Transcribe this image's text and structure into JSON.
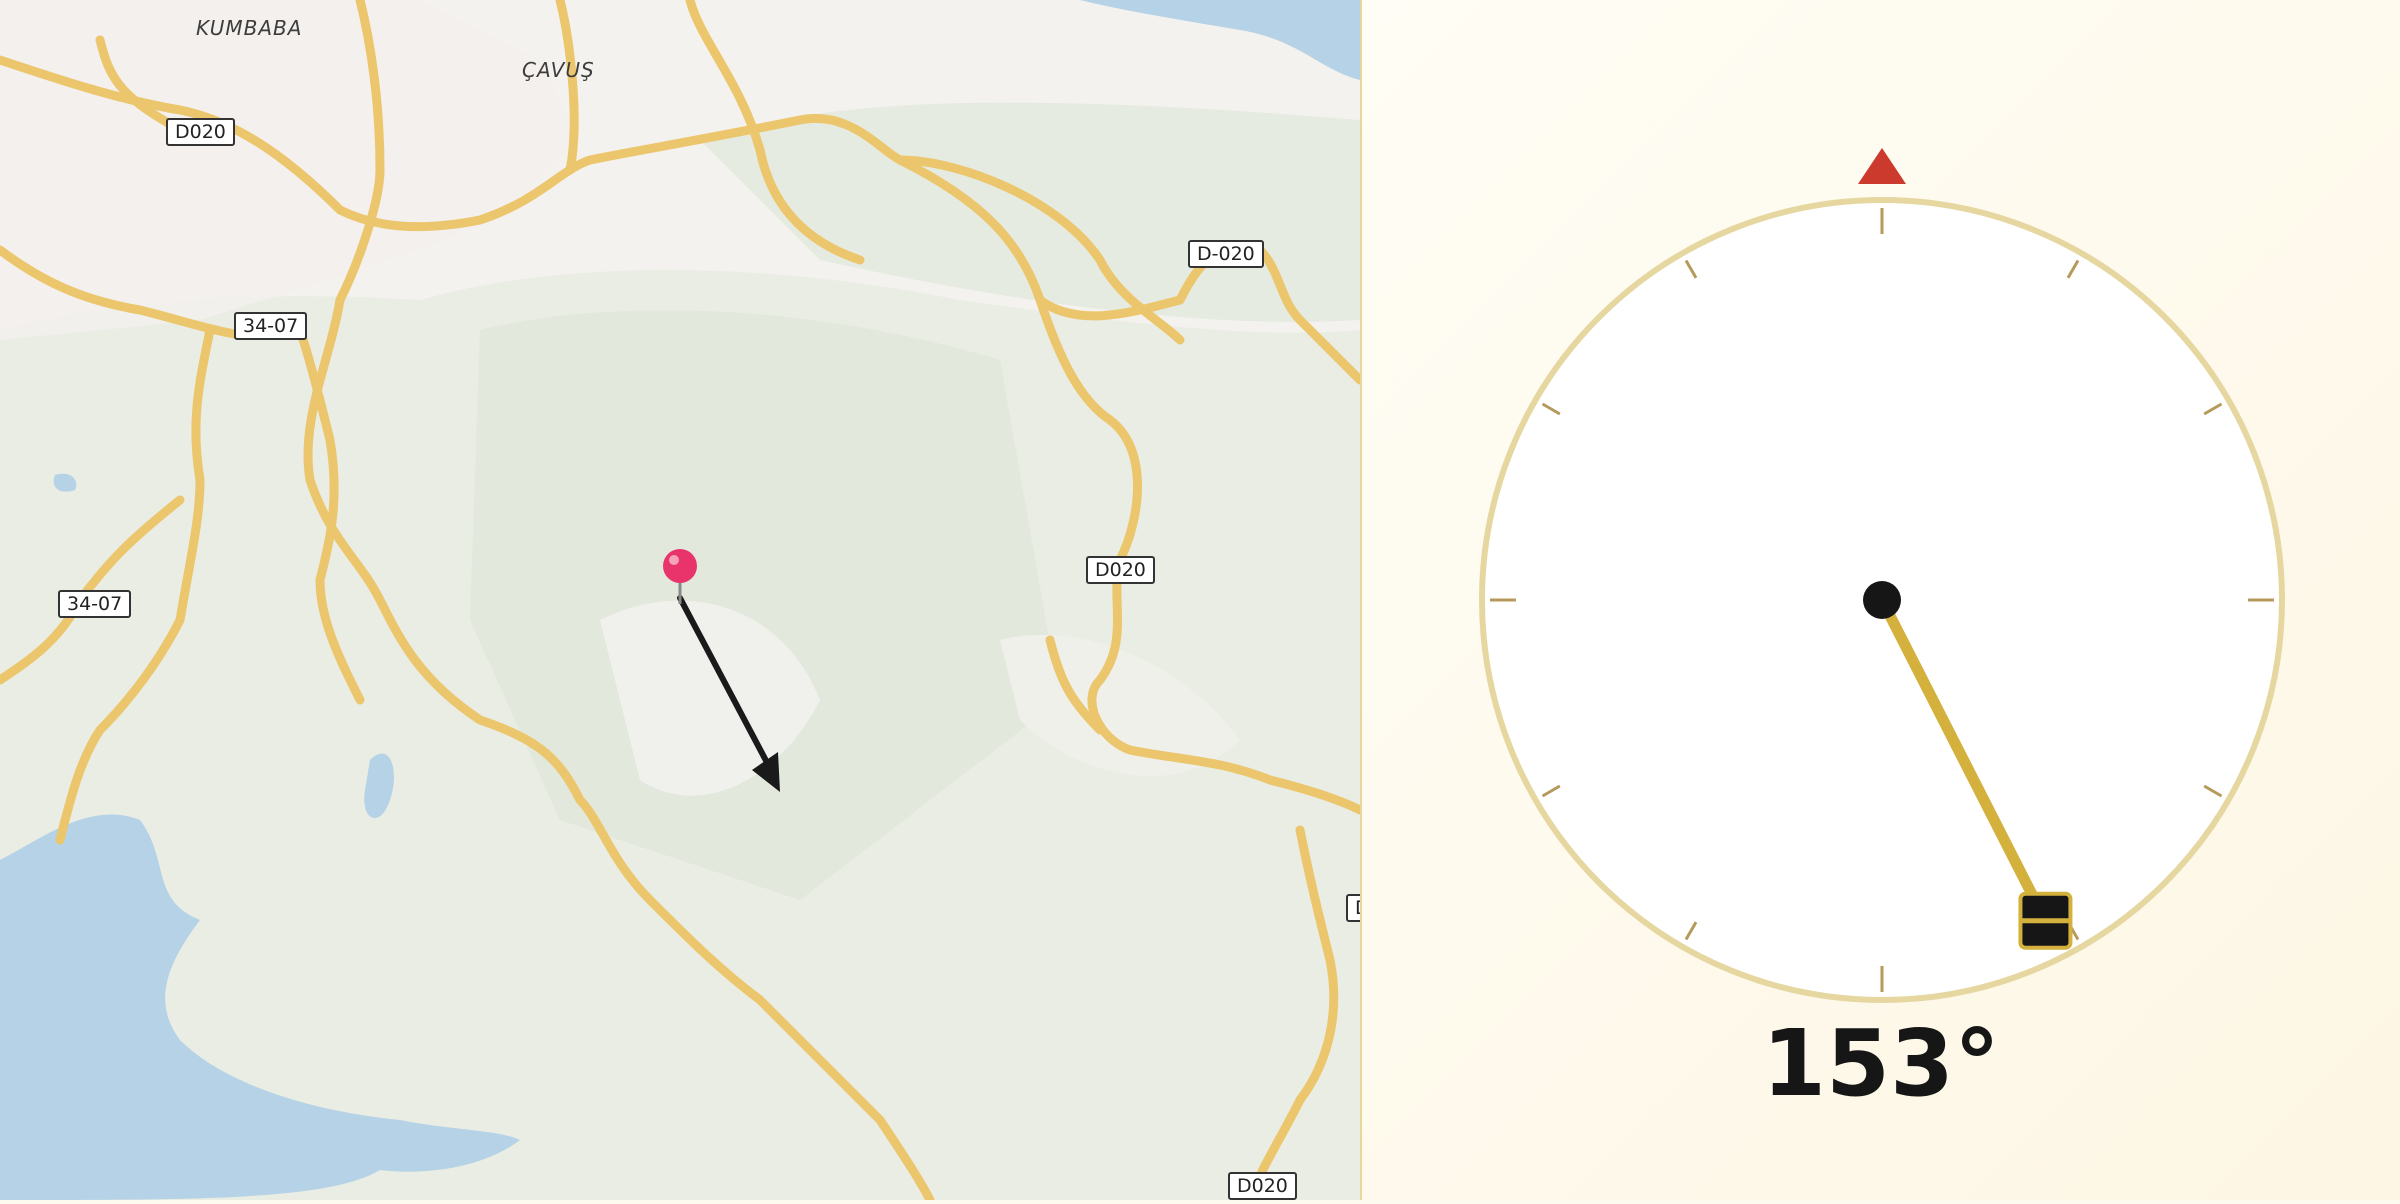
{
  "map": {
    "place_labels": [
      "KUMBABA",
      "ÇAVUŞ"
    ],
    "road_shields": [
      "D020",
      "34-07",
      "D-020",
      "D020",
      "34-07",
      "D020",
      "D"
    ],
    "pin": {
      "color": "#e8336b"
    }
  },
  "compass": {
    "heading_deg": 153,
    "heading_text": "153°",
    "north_marker_color": "#cc3a2e",
    "needle_color": "#d4b13d",
    "ring_color": "#e6d7a0"
  }
}
